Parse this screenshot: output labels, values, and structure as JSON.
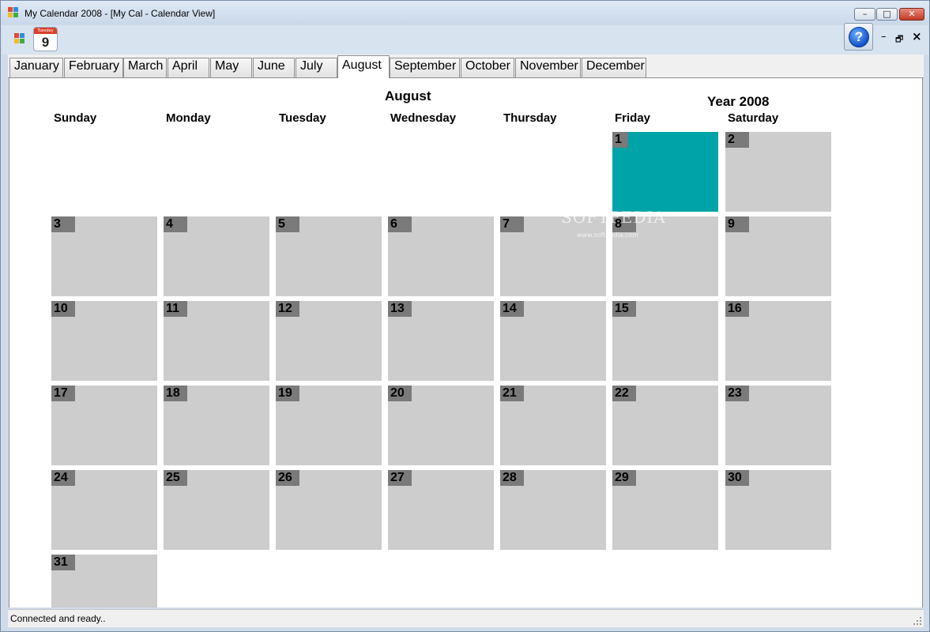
{
  "window": {
    "title": "My Calendar 2008 - [My Cal - Calendar View]",
    "controls": {
      "minimize": "–",
      "maximize": "□",
      "close": "✕"
    }
  },
  "toolbar": {
    "today_icon_label": "Tuesday",
    "today_icon_day": "9",
    "help_label": "?",
    "mdi_minimize": "–",
    "mdi_restore": "🗗",
    "mdi_close": "×"
  },
  "tabs": [
    "January",
    "February",
    "March",
    "April",
    "May",
    "June",
    "July",
    "August",
    "September",
    "October",
    "November",
    "December"
  ],
  "active_tab": "August",
  "calendar": {
    "month_title": "August",
    "year_title": "Year 2008",
    "weekdays": [
      "Sunday",
      "Monday",
      "Tuesday",
      "Wednesday",
      "Thursday",
      "Friday",
      "Saturday"
    ],
    "first_weekday_index": 5,
    "days_in_month": 31,
    "highlighted_day": 1,
    "colors": {
      "day_cell": "#cdcdcd",
      "day_number_badge": "#7a7a7a",
      "highlighted_cell": "#00a3a8"
    }
  },
  "watermark": {
    "main": "SOFTPEDIA",
    "sub": "www.softpedia.com"
  },
  "status": {
    "text": "Connected and ready.."
  }
}
